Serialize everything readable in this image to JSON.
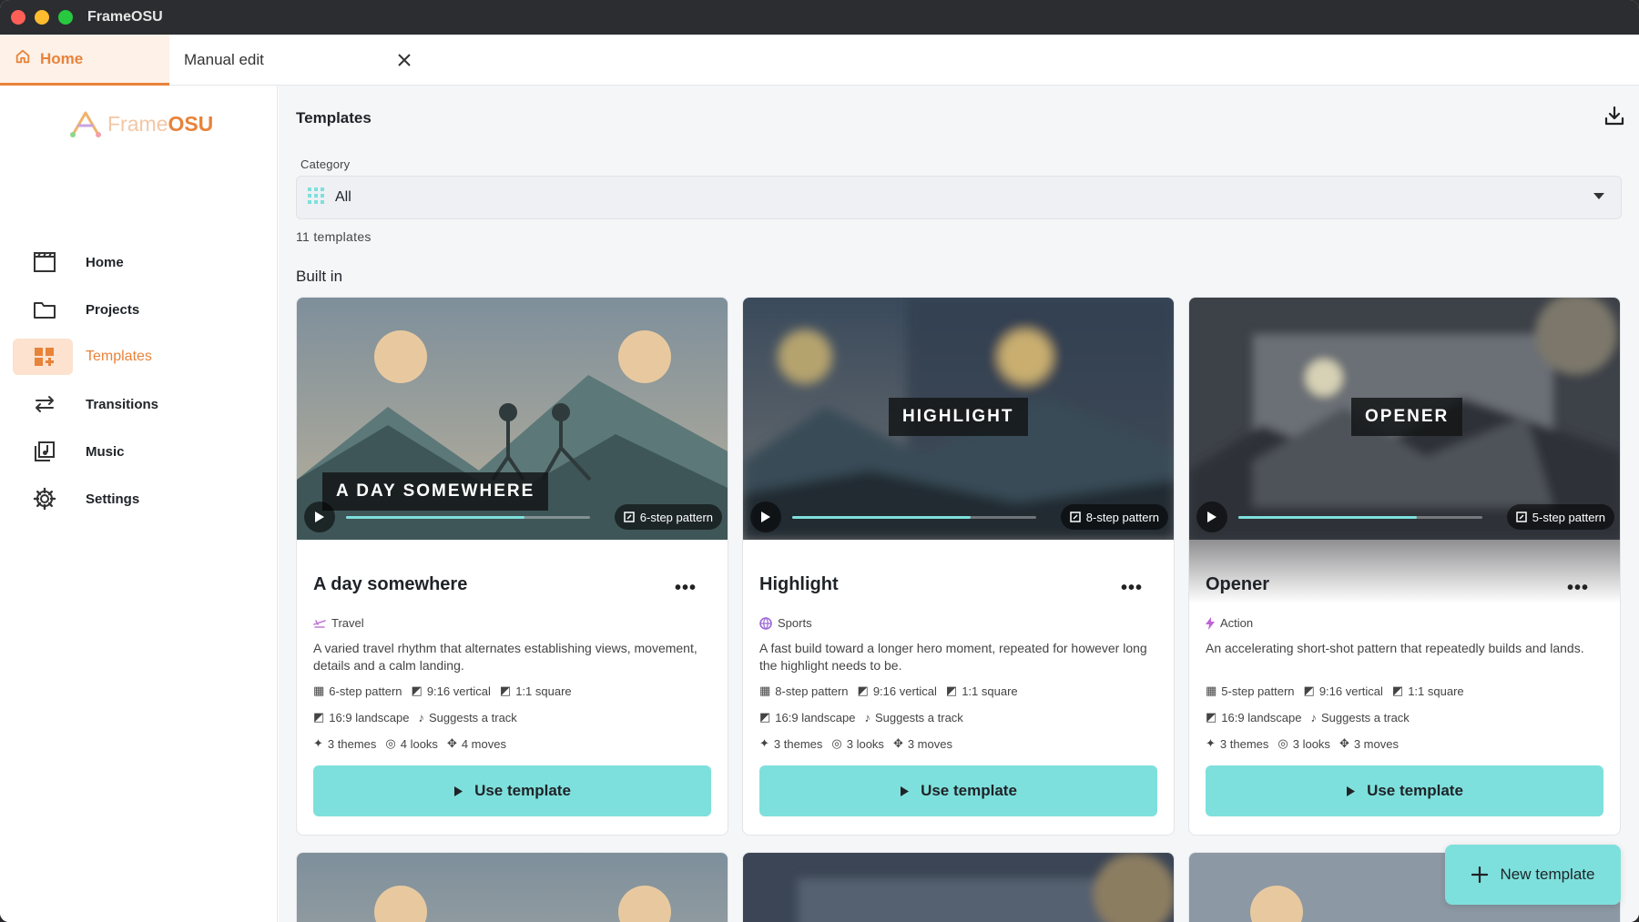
{
  "window": {
    "title": "FrameOSU"
  },
  "tabs": [
    {
      "label": "Home",
      "icon": "home-icon"
    },
    {
      "label": "Manual edit",
      "icon": "close-icon"
    }
  ],
  "logo": {
    "frame": "Frame",
    "osu": "OSU"
  },
  "sidebar": {
    "items": [
      {
        "label": "Home",
        "icon": "clapperboard-icon"
      },
      {
        "label": "Projects",
        "icon": "folder-icon"
      },
      {
        "label": "Templates",
        "icon": "templates-icon",
        "active": true
      },
      {
        "label": "Transitions",
        "icon": "swap-arrows-icon"
      },
      {
        "label": "Music",
        "icon": "music-library-icon"
      },
      {
        "label": "Settings",
        "icon": "gear-icon"
      }
    ]
  },
  "main": {
    "title": "Templates",
    "category_label": "Category",
    "category_value": "All",
    "count": "11 templates",
    "section": "Built in",
    "new_template": "New template"
  },
  "templates": [
    {
      "thumb_title": "A DAY SOMEWHERE",
      "pattern": "6-step pattern",
      "progress": 0.73,
      "name": "A day somewhere",
      "category": "Travel",
      "description": "A varied travel rhythm that alternates establishing views, movement, details and a calm landing.",
      "meta": {
        "pattern": "6-step pattern",
        "vertical": "9:16 vertical",
        "square": "1:1 square",
        "landscape": "16:9 landscape",
        "track": "Suggests a track",
        "themes": "3 themes",
        "looks": "4 looks",
        "moves": "4 moves"
      },
      "action": "Use template"
    },
    {
      "thumb_title": "HIGHLIGHT",
      "pattern": "8-step pattern",
      "progress": 0.73,
      "name": "Highlight",
      "category": "Sports",
      "description": "A fast build toward a longer hero moment, repeated for however long the highlight needs to be.",
      "meta": {
        "pattern": "8-step pattern",
        "vertical": "9:16 vertical",
        "square": "1:1 square",
        "landscape": "16:9 landscape",
        "track": "Suggests a track",
        "themes": "3 themes",
        "looks": "3 looks",
        "moves": "3 moves"
      },
      "action": "Use template"
    },
    {
      "thumb_title": "OPENER",
      "pattern": "5-step pattern",
      "progress": 0.73,
      "name": "Opener",
      "category": "Action",
      "description": "An accelerating short-shot pattern that repeatedly builds and lands.",
      "meta": {
        "pattern": "5-step pattern",
        "vertical": "9:16 vertical",
        "square": "1:1 square",
        "landscape": "16:9 landscape",
        "track": "Suggests a track",
        "themes": "3 themes",
        "looks": "3 looks",
        "moves": "3 moves"
      },
      "action": "Use template"
    }
  ],
  "colors": {
    "accent": "#e8833a",
    "primary_button": "#7ee0dc",
    "titlebar": "#2b2d30"
  }
}
